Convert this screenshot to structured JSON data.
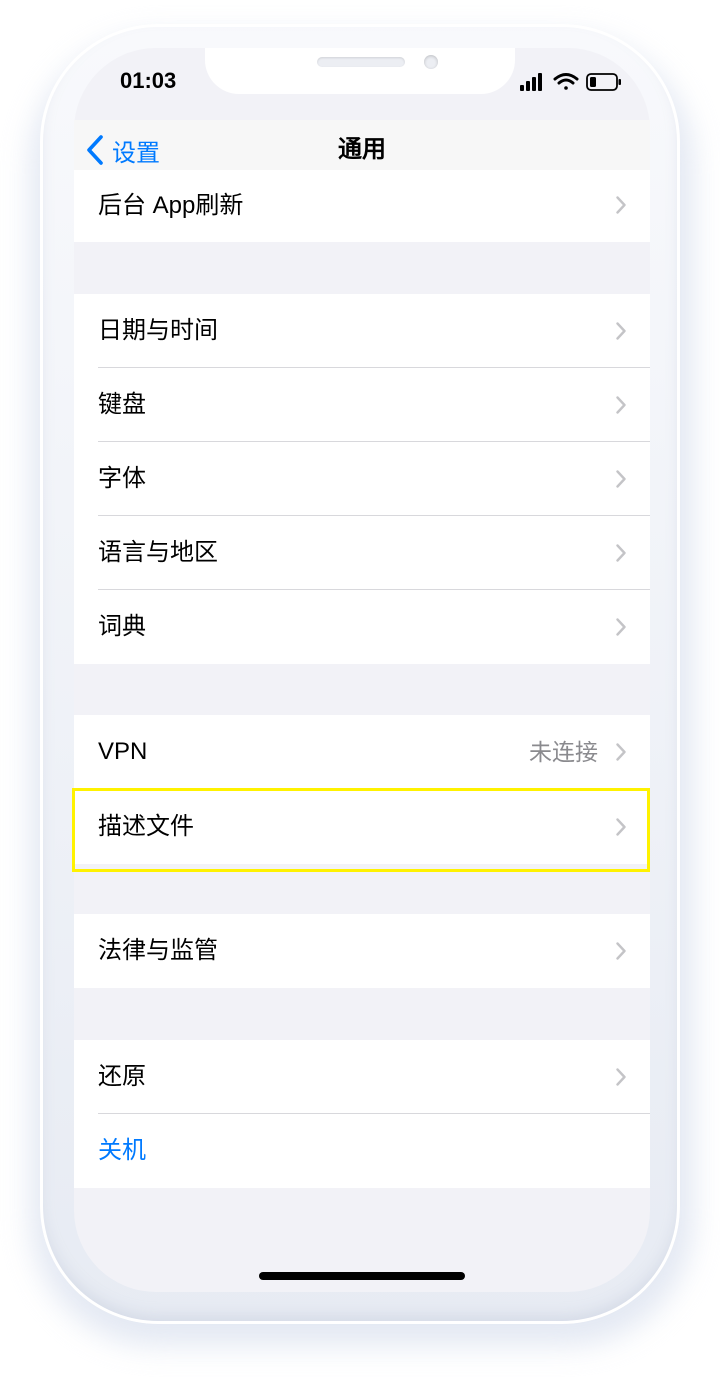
{
  "status": {
    "time": "01:03"
  },
  "navbar": {
    "back_label": "设置",
    "title": "通用"
  },
  "rows": {
    "background_refresh": "后台 App刷新",
    "date_time": "日期与时间",
    "keyboard": "键盘",
    "fonts": "字体",
    "language_region": "语言与地区",
    "dictionary": "词典",
    "vpn": {
      "label": "VPN",
      "detail": "未连接"
    },
    "profiles": "描述文件",
    "legal": "法律与监管",
    "reset": "还原",
    "shutdown": "关机"
  },
  "colors": {
    "accent": "#007aff",
    "highlight": "#fff200",
    "grouped_background": "#f2f2f7"
  },
  "icons": [
    "chevron-left-icon",
    "chevron-right-icon",
    "signal-icon",
    "wifi-icon",
    "battery-icon"
  ]
}
